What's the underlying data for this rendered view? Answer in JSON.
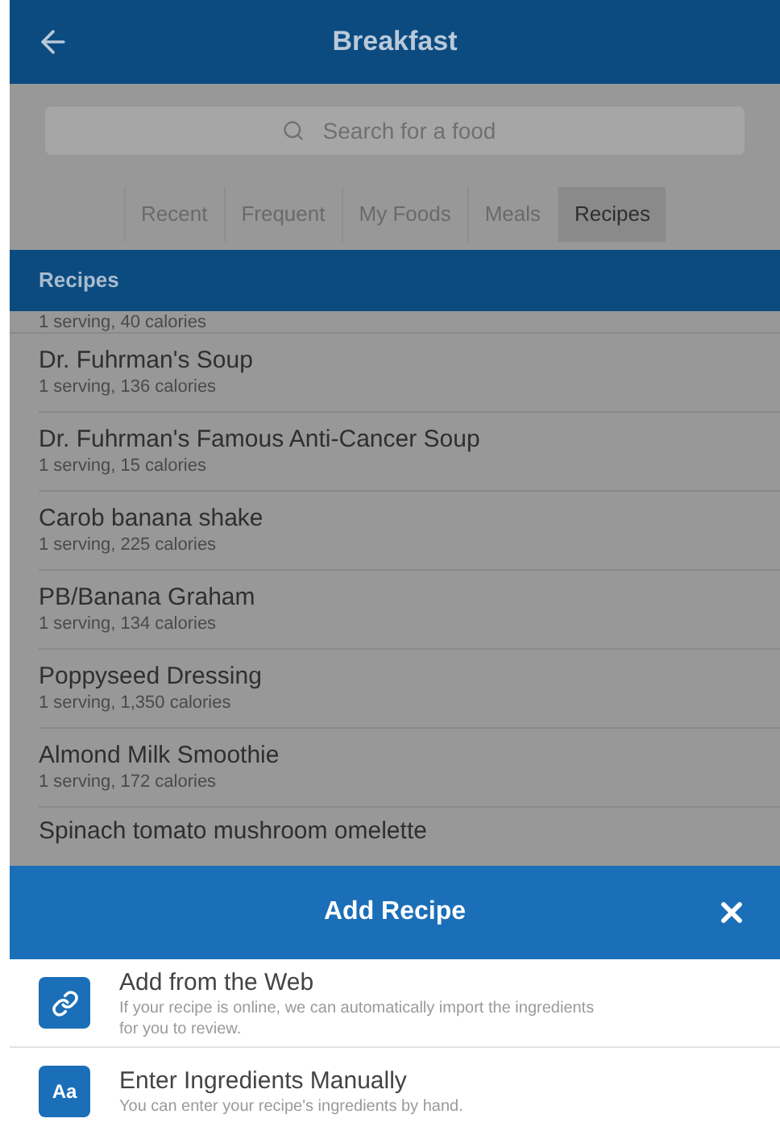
{
  "header": {
    "title": "Breakfast"
  },
  "search": {
    "placeholder": "Search for a food"
  },
  "tabs": [
    {
      "label": "Recent",
      "selected": false
    },
    {
      "label": "Frequent",
      "selected": false
    },
    {
      "label": "My Foods",
      "selected": false
    },
    {
      "label": "Meals",
      "selected": false
    },
    {
      "label": "Recipes",
      "selected": true
    }
  ],
  "section": {
    "title": "Recipes"
  },
  "partial_row": {
    "detail": "1 serving, 40 calories"
  },
  "recipes": [
    {
      "name": "Dr. Fuhrman's Soup",
      "detail": "1 serving, 136 calories"
    },
    {
      "name": "Dr. Fuhrman's Famous Anti-Cancer Soup",
      "detail": "1 serving, 15 calories"
    },
    {
      "name": "Carob banana shake",
      "detail": "1 serving, 225 calories"
    },
    {
      "name": "PB/Banana Graham",
      "detail": "1 serving, 134 calories"
    },
    {
      "name": "Poppyseed Dressing",
      "detail": "1 serving, 1,350 calories"
    },
    {
      "name": "Almond Milk Smoothie",
      "detail": "1 serving, 172 calories"
    }
  ],
  "cut_row": {
    "name": "Spinach tomato mushroom omelette"
  },
  "sheet": {
    "title": "Add Recipe",
    "options": [
      {
        "kind": "web",
        "title": "Add from the Web",
        "description": "If your recipe is online, we can automatically import the ingredients for you to review."
      },
      {
        "kind": "manual",
        "icon_text": "Aa",
        "title": "Enter Ingredients Manually",
        "description": "You can enter your recipe's ingredients by hand."
      }
    ]
  }
}
